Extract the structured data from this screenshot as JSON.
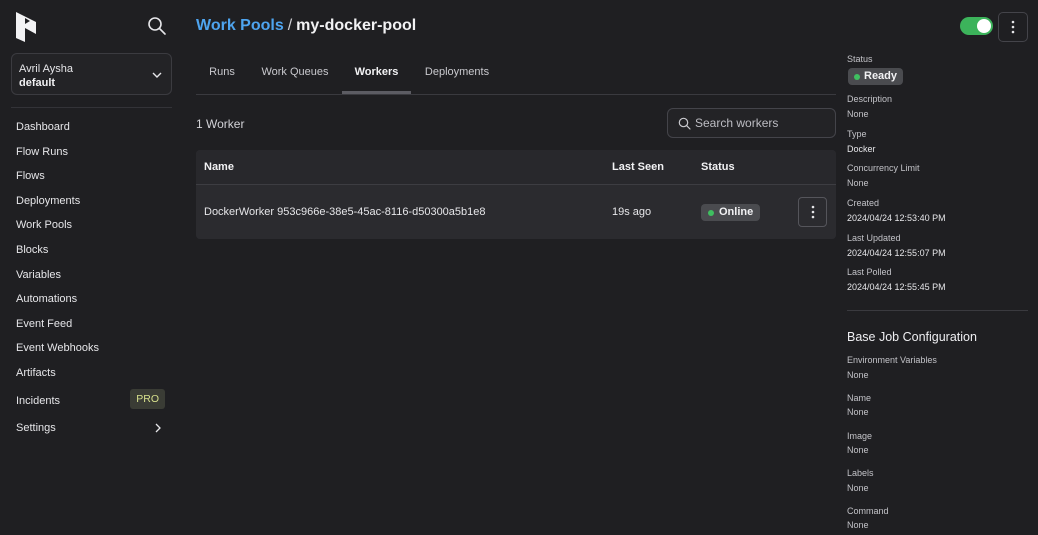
{
  "sidebar": {
    "workspace": {
      "user": "Avril Aysha",
      "name": "default"
    },
    "nav": [
      {
        "label": "Dashboard"
      },
      {
        "label": "Flow Runs"
      },
      {
        "label": "Flows"
      },
      {
        "label": "Deployments"
      },
      {
        "label": "Work Pools"
      },
      {
        "label": "Blocks"
      },
      {
        "label": "Variables"
      },
      {
        "label": "Automations"
      },
      {
        "label": "Event Feed"
      },
      {
        "label": "Event Webhooks"
      },
      {
        "label": "Artifacts"
      },
      {
        "label": "Incidents",
        "badge": "PRO"
      },
      {
        "label": "Settings"
      }
    ]
  },
  "header": {
    "breadcrumb_parent": "Work Pools",
    "breadcrumb_sep": "/",
    "breadcrumb_current": "my-docker-pool",
    "toggle_on": true
  },
  "tabs": [
    {
      "label": "Runs"
    },
    {
      "label": "Work Queues"
    },
    {
      "label": "Workers",
      "active": true
    },
    {
      "label": "Deployments"
    }
  ],
  "workers": {
    "count_label": "1 Worker",
    "search_placeholder": "Search workers",
    "columns": {
      "name": "Name",
      "last_seen": "Last Seen",
      "status": "Status"
    },
    "rows": [
      {
        "name": "DockerWorker 953c966e-38e5-45ac-8116-d50300a5b1e8",
        "last_seen": "19s ago",
        "status": "Online"
      }
    ]
  },
  "details": {
    "status_label": "Status",
    "status_value": "Ready",
    "description_label": "Description",
    "description_value": "None",
    "type_label": "Type",
    "type_value": "Docker",
    "concurrency_label": "Concurrency Limit",
    "concurrency_value": "None",
    "created_label": "Created",
    "created_value": "2024/04/24 12:53:40 PM",
    "updated_label": "Last Updated",
    "updated_value": "2024/04/24 12:55:07 PM",
    "polled_label": "Last Polled",
    "polled_value": "2024/04/24 12:55:45 PM",
    "base_job_title": "Base Job Configuration",
    "env_label": "Environment Variables",
    "env_value": "None",
    "name_label": "Name",
    "name_value": "None",
    "image_label": "Image",
    "image_value": "None",
    "labels_label": "Labels",
    "labels_value": "None",
    "command_label": "Command",
    "command_value": "None"
  },
  "colors": {
    "accent_link": "#4ea4ef",
    "status_green": "#3fbf60",
    "toggle_green": "#3cb35b",
    "pro_badge_text": "#d7e08c",
    "background": "#1f1f22"
  }
}
